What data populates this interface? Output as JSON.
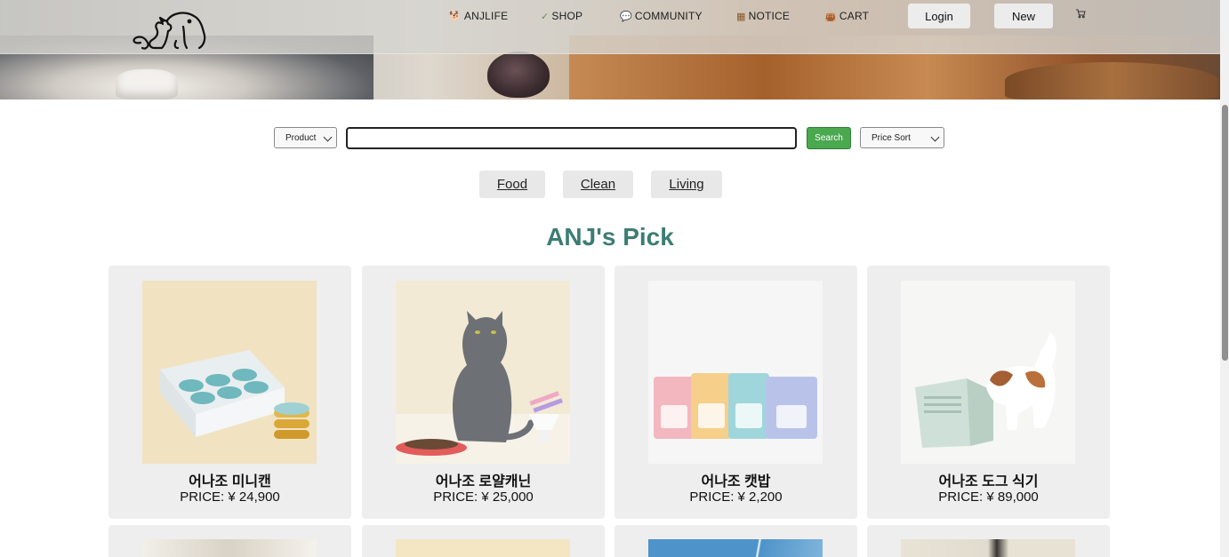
{
  "nav": {
    "items": [
      {
        "icon": "🐕",
        "label": "ANJLIFE"
      },
      {
        "icon": "✓",
        "label": "SHOP"
      },
      {
        "icon": "💬",
        "label": "COMMUNITY"
      },
      {
        "icon": "▦",
        "label": "NOTICE"
      },
      {
        "icon": "👜",
        "label": "CART"
      }
    ],
    "login_label": "Login",
    "new_label": "New"
  },
  "search": {
    "category_select": "Product",
    "query_value": "",
    "button_label": "Search",
    "sort_select": "Price Sort"
  },
  "categories": [
    "Food",
    "Clean",
    "Living"
  ],
  "section_title": "ANJ's Pick",
  "products": [
    {
      "name": "어나조 미니캔",
      "price": "PRICE: ¥ 24,900"
    },
    {
      "name": "어나조 로얄캐닌",
      "price": "PRICE: ¥ 25,000"
    },
    {
      "name": "어나조 캣밥",
      "price": "PRICE: ¥ 2,200"
    },
    {
      "name": "어나조 도그 식기",
      "price": "PRICE: ¥ 89,000"
    }
  ],
  "colors": {
    "accent_title": "#3b7d74",
    "search_button": "#4aa84f",
    "card_bg": "#eeeeee"
  }
}
